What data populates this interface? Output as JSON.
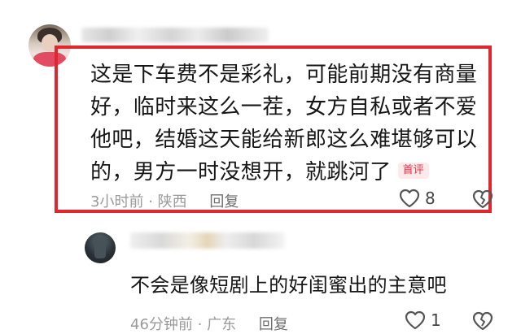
{
  "comment": {
    "lines": [
      "这是下车费不是彩礼，可能前期没有商量",
      "好，临时来这么一茬，女方自私或者不爱",
      "他吧，结婚这天能给新郎这么难堪够可以",
      "的，男方一时没想开，就跳河了"
    ],
    "badge": "首评",
    "time": "3小时前",
    "separator": "·",
    "location": "陕西",
    "reply_label": "回复",
    "like_count": "8"
  },
  "reply": {
    "text": "不会是像短剧上的好闺蜜出的主意吧",
    "time": "46分钟前",
    "separator": "·",
    "location": "广东",
    "reply_label": "回复",
    "like_count": "1"
  },
  "colors": {
    "highlight_border": "#e0262f",
    "badge_text": "#e0364a",
    "meta_text": "#9a9a9a"
  },
  "icons": [
    "heart-outline-icon",
    "broken-heart-icon"
  ]
}
